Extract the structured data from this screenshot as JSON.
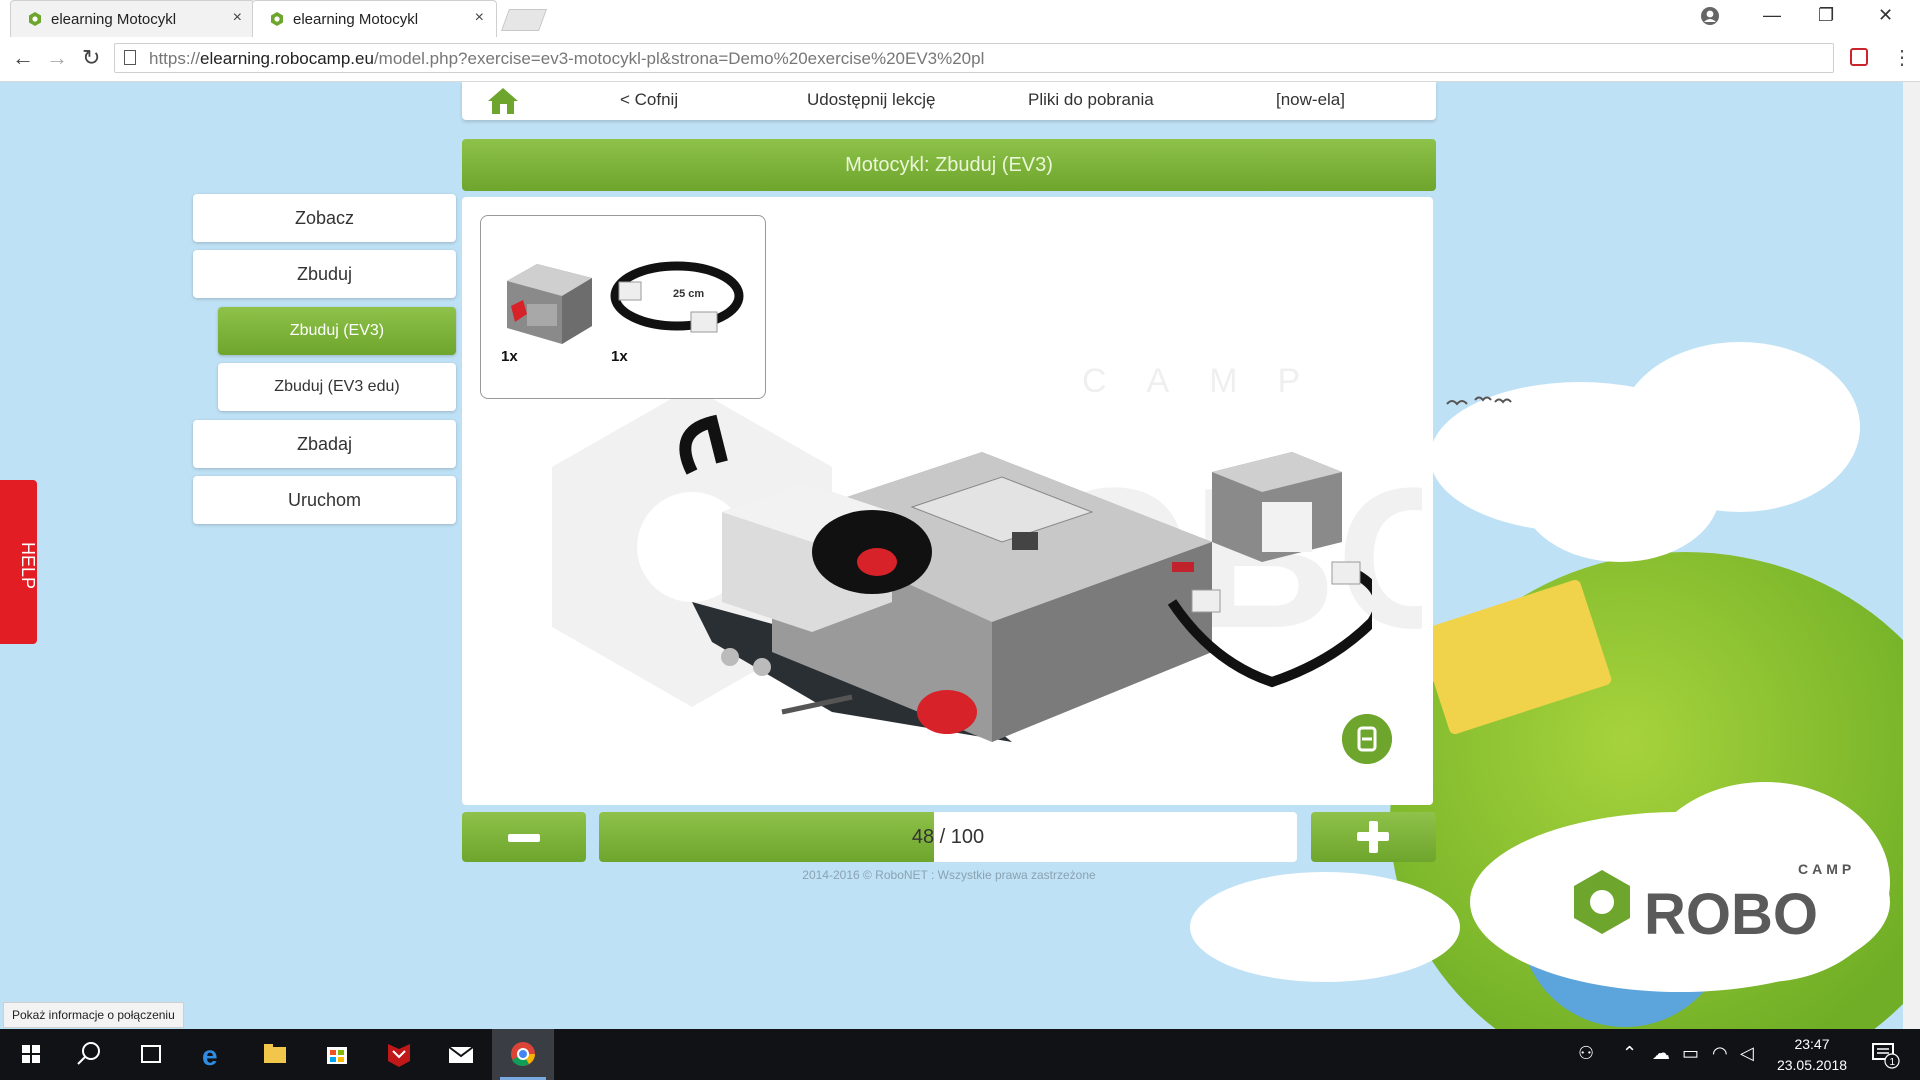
{
  "browser": {
    "tabs": [
      {
        "title": "elearning Motocykl",
        "close": "×",
        "active": false
      },
      {
        "title": "elearning Motocykl",
        "close": "×",
        "active": true
      }
    ],
    "window_controls": {
      "minimize": "—",
      "restore": "❐",
      "close": "✕"
    },
    "nav": {
      "back": "←",
      "forward": "→",
      "reload": "↻"
    },
    "url": {
      "scheme": "https://",
      "host": "elearning.robocamp.eu",
      "path": "/model.php?exercise=ev3-motocykl-pl&strona=Demo%20exercise%20EV3%20pl"
    },
    "menu": "⋮"
  },
  "topnav": {
    "back_label": "< Cofnij",
    "share_label": "Udostępnij lekcję",
    "downloads_label": "Pliki do pobrania",
    "user_label": "[now-ela]"
  },
  "title": "Motocykl: Zbuduj (EV3)",
  "sidebar": {
    "items": [
      {
        "label": "Zobacz",
        "level": 1,
        "active": false
      },
      {
        "label": "Zbuduj",
        "level": 1,
        "active": false
      },
      {
        "label": "Zbuduj (EV3)",
        "level": 2,
        "active": true
      },
      {
        "label": "Zbuduj (EV3 edu)",
        "level": 2,
        "active": false
      },
      {
        "label": "Zbadaj",
        "level": 1,
        "active": false
      },
      {
        "label": "Uruchom",
        "level": 1,
        "active": false
      }
    ]
  },
  "help_label": "HELP",
  "parts": {
    "sensor_qty": "1x",
    "cable_qty": "1x",
    "cable_length": "25 cm"
  },
  "watermark_text": "CAMP",
  "progress": {
    "current": 48,
    "total": 100,
    "current_text": "48",
    "total_text": "/ 100"
  },
  "footer": "2014-2016 © RoboNET : Wszystkie prawa zastrzeżone",
  "logo": {
    "small": "CAMP",
    "big": "ROBO"
  },
  "status_bubble": "Pokaż informacje o połączeniu",
  "taskbar": {
    "clock_time": "23:47",
    "clock_date": "23.05.2018",
    "notification_count": "1"
  },
  "colors": {
    "accent_green": "#6ea52c",
    "help_red": "#e21d24",
    "sky": "#bfe1f5"
  }
}
